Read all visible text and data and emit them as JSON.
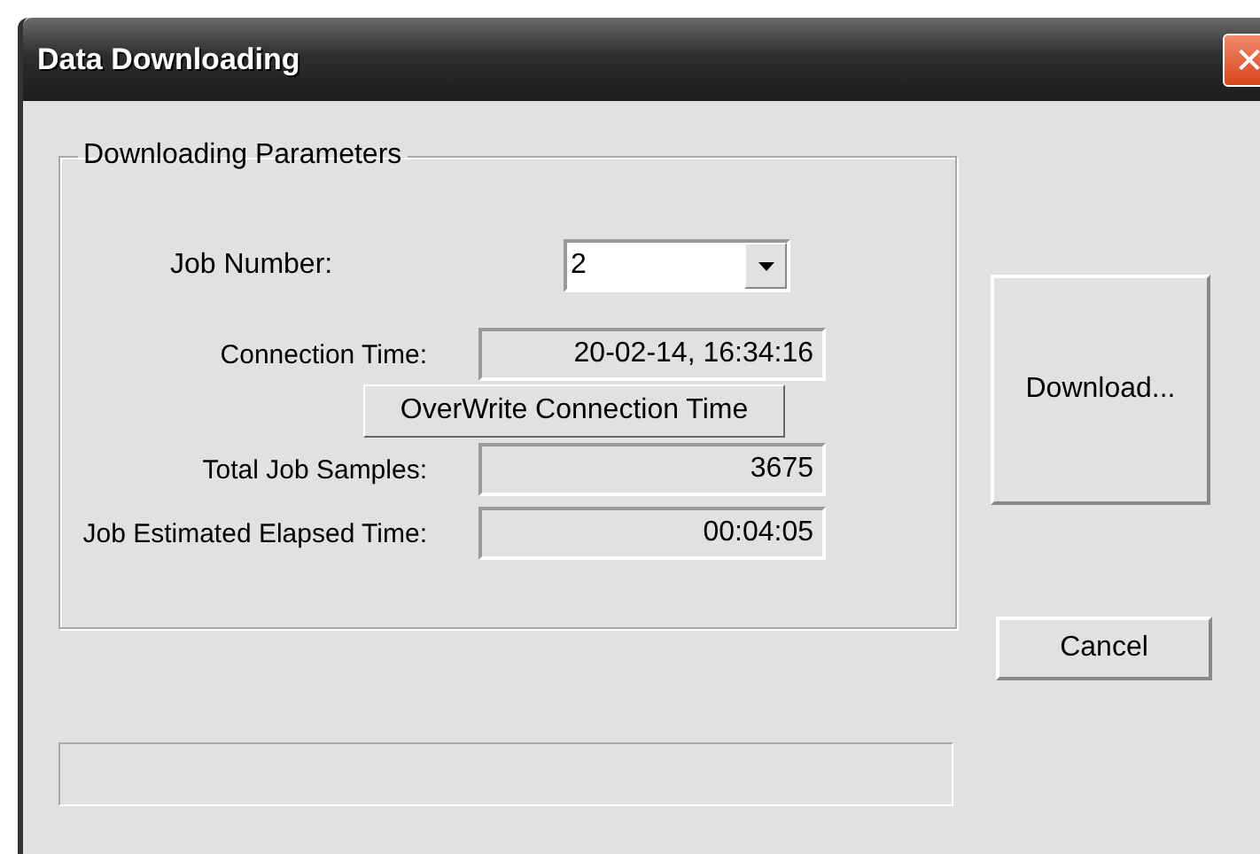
{
  "window": {
    "title": "Data Downloading",
    "close": "✕"
  },
  "group": {
    "title": "Downloading Parameters",
    "job_number": {
      "label": "Job Number:",
      "value": "2"
    },
    "connection_time": {
      "label": "Connection Time:",
      "value": "20-02-14, 16:34:16"
    },
    "overwrite_button": "OverWrite Connection Time",
    "total_samples": {
      "label": "Total Job Samples:",
      "value": "3675"
    },
    "elapsed_time": {
      "label": "Job Estimated Elapsed Time:",
      "value": "00:04:05"
    }
  },
  "buttons": {
    "download": "Download...",
    "cancel": "Cancel"
  },
  "progress": {
    "level": 0
  }
}
